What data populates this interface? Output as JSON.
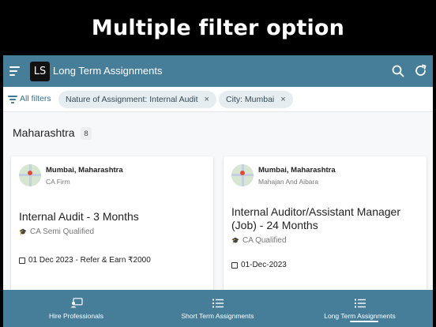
{
  "banner": {
    "title": "Multiple filter option"
  },
  "app": {
    "logo": "LS",
    "title": "Long Term Assignments",
    "menu_icon": "hamburger-menu-icon",
    "search_icon": "search-icon",
    "refresh_icon": "refresh-icon",
    "accent": "#467e9a"
  },
  "filters": {
    "label": "All filters",
    "chips": [
      {
        "label": "Nature of Assignment: Internal Audit",
        "remove": "×"
      },
      {
        "label": "City: Mumbai",
        "remove": "×"
      }
    ]
  },
  "section": {
    "title": "Maharashtra",
    "count": "8"
  },
  "cards": [
    {
      "location": "Mumbai, Maharashtra",
      "firm": "CA Firm",
      "title_line1": "Internal Audit - 3 Months",
      "title_line2": "",
      "qualification": "CA Semi Qualified",
      "date": "01 Dec 2023 - Refer & Earn ₹2000"
    },
    {
      "location": "Mumbai, Maharashtra",
      "firm": "Mahajan And Aibara",
      "title_line1": "Internal Auditor/Assistant Manager",
      "title_line2": "(Job) - 24 Months",
      "qualification": "CA Qualified",
      "date": "01-Dec-2023"
    }
  ],
  "bottom_nav": [
    {
      "label": "Hire Professionals",
      "icon": "hire-professionals-icon"
    },
    {
      "label": "Short Term Assignments",
      "icon": "list-icon"
    },
    {
      "label": "Long Term Assignments",
      "icon": "list-icon",
      "active": true
    }
  ]
}
